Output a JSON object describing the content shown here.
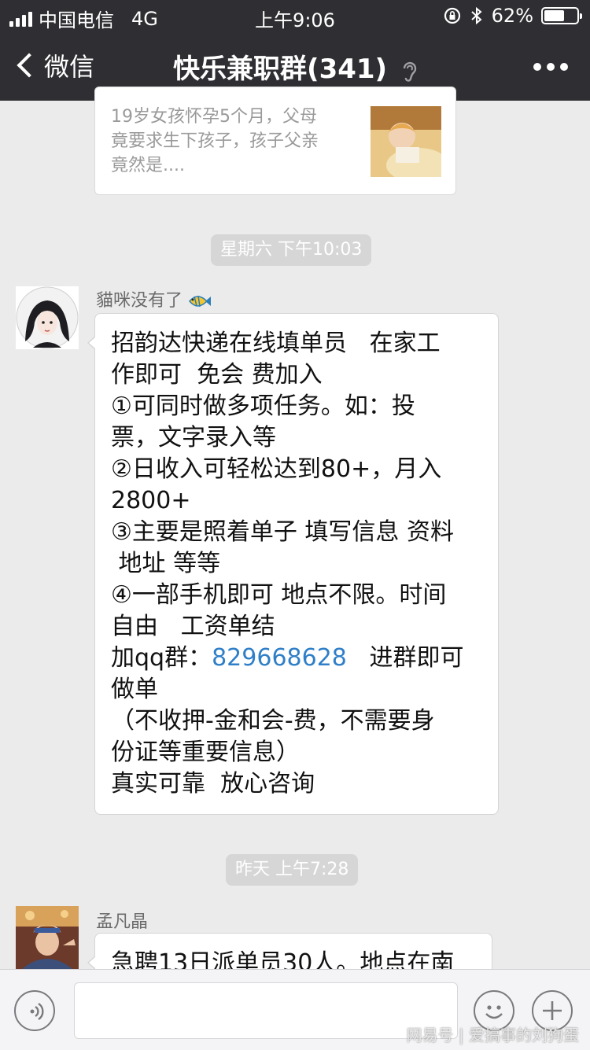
{
  "status_bar": {
    "carrier": "中国电信",
    "network": "4G",
    "time": "上午9:06",
    "battery_text": "62%",
    "battery_level": 0.62
  },
  "nav": {
    "back_label": "微信",
    "title": "快乐兼职群(341)"
  },
  "article_card": {
    "lines": [
      "19岁女孩怀孕5个月，父母",
      "竟要求生下孩子，孩子父亲",
      "竟然是...."
    ]
  },
  "timestamps": {
    "first": "星期六 下午10:03",
    "second": "昨天 上午7:28"
  },
  "messages": [
    {
      "sender": "貓咪没有了",
      "lines": [
        "招韵达快递在线填单员   在家工",
        "作即可  免会 费加入",
        "①可同时做多项任务。如：投",
        "票，文字录入等",
        "②日收入可轻松达到80+，月入",
        "2800+",
        "③主要是照着单子 填写信息 资料",
        " 地址 等等",
        "④一部手机即可 地点不限。时间",
        "自由   工资单结"
      ],
      "qq_prefix": "加qq群：",
      "qq_number": "829668628",
      "qq_suffix": "   进群即可",
      "lines_after": [
        "做单",
        "（不收押-金和会-费，不需要身",
        "份证等重要信息）",
        "真实可靠  放心咨询"
      ]
    },
    {
      "sender": "孟凡晶",
      "lines": [
        "急聘13日派单员30人。地点在南"
      ]
    }
  ],
  "watermark": "网易号 | 爱搞事的刘狗蛋",
  "colors": {
    "header_bg": "#2f2f33",
    "chat_bg": "#ebebeb",
    "link": "#2f7fc8",
    "timestamp_bg": "#d6d6d6"
  }
}
